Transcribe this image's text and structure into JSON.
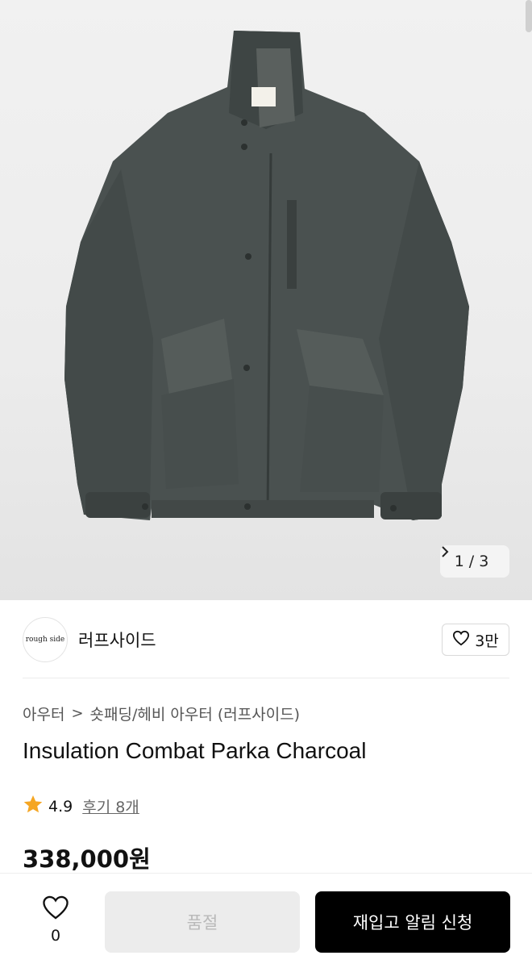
{
  "gallery": {
    "current": "1",
    "separator": "/",
    "total": "3",
    "next_icon": "chevron-right-icon"
  },
  "brand": {
    "logo_text": "rough side",
    "name": "러프사이드",
    "like_icon": "heart-outline-icon",
    "like_count": "3만"
  },
  "breadcrumb": {
    "items": [
      "아우터",
      "숏패딩/헤비 아우터 (러프사이드)"
    ],
    "separator": ">"
  },
  "product": {
    "title": "Insulation Combat Parka Charcoal",
    "rating_icon": "star-icon",
    "rating": "4.9",
    "reviews": "후기 8개",
    "price": "338,000원"
  },
  "bottom_bar": {
    "wish_icon": "heart-outline-icon",
    "wish_count": "0",
    "soldout_label": "품절",
    "restock_label": "재입고 알림 신청"
  },
  "colors": {
    "accent_star": "#f5a623",
    "primary_button": "#000000",
    "disabled_button": "#ececec",
    "jacket": "#4a5150"
  }
}
